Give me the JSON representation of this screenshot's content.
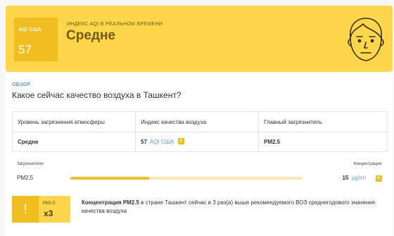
{
  "header": {
    "aqi_label": "AQI США",
    "aqi_value": "57",
    "realtime_label": "ИНДЕКС AQI В РЕАЛЬНОМ ВРЕМЕНИ",
    "level": "Средне",
    "face_icon": "face-moderate-icon"
  },
  "overview": {
    "section_label": "ОБЗОР",
    "question": "Какое сейчас качество воздуха в Ташкент?"
  },
  "table": {
    "headers": [
      "Уровень загрязнения атмосферы",
      "Индекс качества воздуха",
      "Главный загрязнитель"
    ],
    "level_value": "Средне",
    "aqi_number": "57",
    "aqi_unit": "AQI США",
    "main_pollutant": "PM2.5"
  },
  "pollutants": {
    "header_left": "Загрязнители",
    "header_right": "Концентрация",
    "items": [
      {
        "name": "PM2.5",
        "value": "15",
        "unit": "µg/m³",
        "level_fraction": 0.34
      }
    ]
  },
  "warning": {
    "icon": "!",
    "pollutant": "PM2.5",
    "multiplier": "x3",
    "text_bold": "Концентрация PM2.5",
    "text_rest": " в стране Ташкент сейчас в 3 раз(а) выше рекомендуемого ВОЗ среднегодового значения качества воздуха"
  },
  "colors": {
    "banner": "#fdd64b",
    "accent": "#f0be1f",
    "link": "#5a9fd4"
  }
}
